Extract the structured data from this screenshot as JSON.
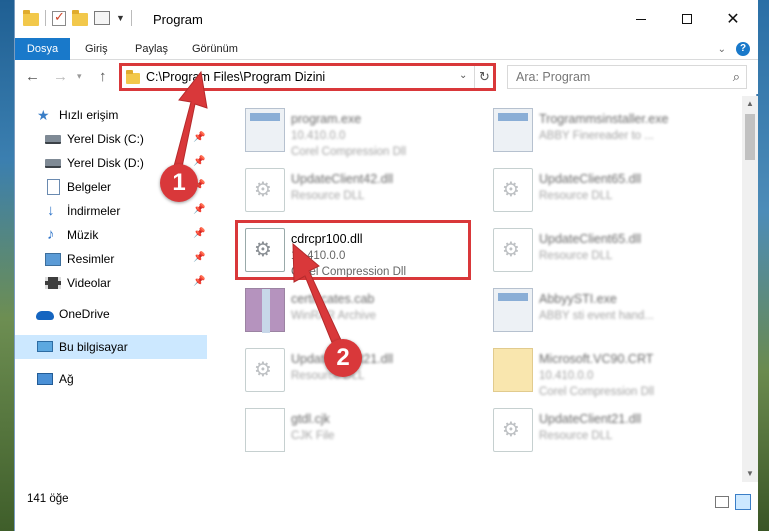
{
  "window": {
    "title": "Program",
    "minimize_glyph": "",
    "close_glyph": "✕"
  },
  "ribbon": {
    "tabs": [
      "Dosya",
      "Giriş",
      "Paylaş",
      "Görünüm"
    ],
    "help_glyph": "?"
  },
  "navigation": {
    "address_path": "C:\\Program Files\\Program Dizini",
    "search_placeholder": "Ara: Program"
  },
  "sidebar": {
    "items": [
      {
        "label": "Hızlı erişim",
        "icon": "star-icon"
      },
      {
        "label": "Yerel Disk (C:)",
        "icon": "drive-icon",
        "pinned": true
      },
      {
        "label": "Yerel Disk (D:)",
        "icon": "drive-icon",
        "pinned": true
      },
      {
        "label": "Belgeler",
        "icon": "documents-icon",
        "pinned": true
      },
      {
        "label": "İndirmeler",
        "icon": "downloads-icon",
        "pinned": true
      },
      {
        "label": "Müzik",
        "icon": "music-icon",
        "pinned": true
      },
      {
        "label": "Resimler",
        "icon": "pictures-icon",
        "pinned": true
      },
      {
        "label": "Videolar",
        "icon": "videos-icon",
        "pinned": true
      },
      {
        "label": "OneDrive",
        "icon": "onedrive-icon"
      },
      {
        "label": "Bu bilgisayar",
        "icon": "computer-icon",
        "selected": true
      },
      {
        "label": "Ağ",
        "icon": "network-icon"
      }
    ]
  },
  "files": [
    {
      "name": "program.exe",
      "line1": "10.410.0.0",
      "line2": "Corel Compression Dll",
      "icon": "exe-icon",
      "blurred": true
    },
    {
      "name": "Trogrammsinstaller.exe",
      "line1": "ABBY Finereader to ...",
      "line2": "",
      "icon": "exe-icon",
      "blurred": true
    },
    {
      "name": "UpdateClient42.dll",
      "line1": "Resource DLL",
      "line2": "",
      "icon": "dll-gear-icon",
      "blurred": true
    },
    {
      "name": "UpdateClient65.dll",
      "line1": "Resource DLL",
      "line2": "",
      "icon": "dll-gear-icon",
      "blurred": true
    },
    {
      "name": "cdrcpr100.dll",
      "line1": "10.410.0.0",
      "line2": "Corel Compression Dll",
      "icon": "dll-gear-icon",
      "blurred": false
    },
    {
      "name": "UpdateClient65.dll",
      "line1": "Resource DLL",
      "line2": "",
      "icon": "dll-gear-icon",
      "blurred": true
    },
    {
      "name": "certificates.cab",
      "line1": "WinRAR Archive",
      "line2": "",
      "icon": "cab-archive-icon",
      "blurred": true
    },
    {
      "name": "AbbyySTI.exe",
      "line1": "ABBY sti event hand...",
      "line2": "",
      "icon": "exe-icon",
      "blurred": true
    },
    {
      "name": "UpdateClient21.dll",
      "line1": "Resource DLL",
      "line2": "",
      "icon": "dll-gear-icon",
      "blurred": true
    },
    {
      "name": "Microsoft.VC90.CRT",
      "line1": "10.410.0.0",
      "line2": "Corel Compression Dll",
      "icon": "folder-icon",
      "blurred": true
    },
    {
      "name": "gtdl.cjk",
      "line1": "CJK File",
      "line2": "",
      "icon": "document-icon",
      "blurred": true
    },
    {
      "name": "UpdateClient21.dll",
      "line1": "Resource DLL",
      "line2": "",
      "icon": "dll-gear-icon",
      "blurred": true
    }
  ],
  "annotations": {
    "marker_1": "1",
    "marker_2": "2",
    "color": "#d9383a"
  },
  "status": {
    "item_count": "141 öğe"
  },
  "colors": {
    "accent": "#1979ca",
    "selection": "#cce8ff"
  }
}
